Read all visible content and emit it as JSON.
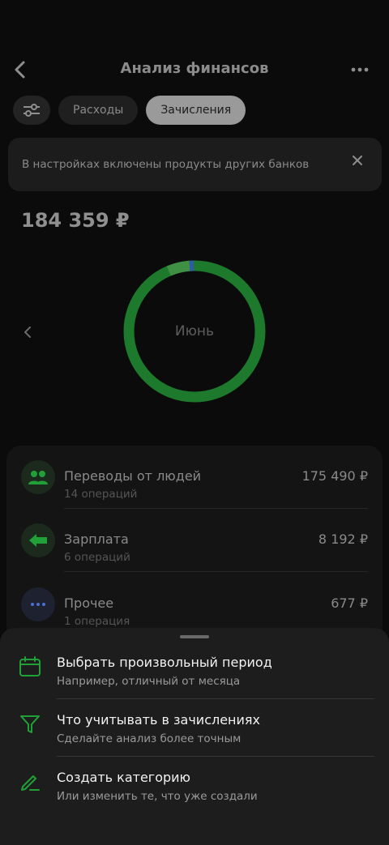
{
  "header": {
    "title": "Анализ финансов"
  },
  "filters": {
    "tabs": [
      {
        "label": "Расходы",
        "active": false
      },
      {
        "label": "Зачисления",
        "active": true
      }
    ]
  },
  "banner": {
    "text": "В настройках включены продукты других банков"
  },
  "summary": {
    "total": "184 359 ₽",
    "month": "Июнь"
  },
  "categories": [
    {
      "name": "Переводы от людей",
      "count": "14 операций",
      "amount": "175 490 ₽",
      "icon": "people-icon"
    },
    {
      "name": "Зарплата",
      "count": "6 операций",
      "amount": "8 192 ₽",
      "icon": "arrow-left-icon"
    },
    {
      "name": "Прочее",
      "count": "1 операция",
      "amount": "677 ₽",
      "icon": "dots-icon"
    }
  ],
  "sheet": {
    "items": [
      {
        "title": "Выбрать произвольный период",
        "subtitle": "Например, отличный от месяца",
        "icon": "calendar-icon"
      },
      {
        "title": "Что учитывать в зачислениях",
        "subtitle": "Сделайте анализ более точным",
        "icon": "funnel-icon"
      },
      {
        "title": "Создать категорию",
        "subtitle": "Или изменить те, что уже создали",
        "icon": "pencil-icon"
      }
    ]
  },
  "colors": {
    "accent_green": "#21a038",
    "ring_green": "#1d7a2c",
    "ring_light": "#3f8f45",
    "ring_blue": "#2e5aa8"
  }
}
